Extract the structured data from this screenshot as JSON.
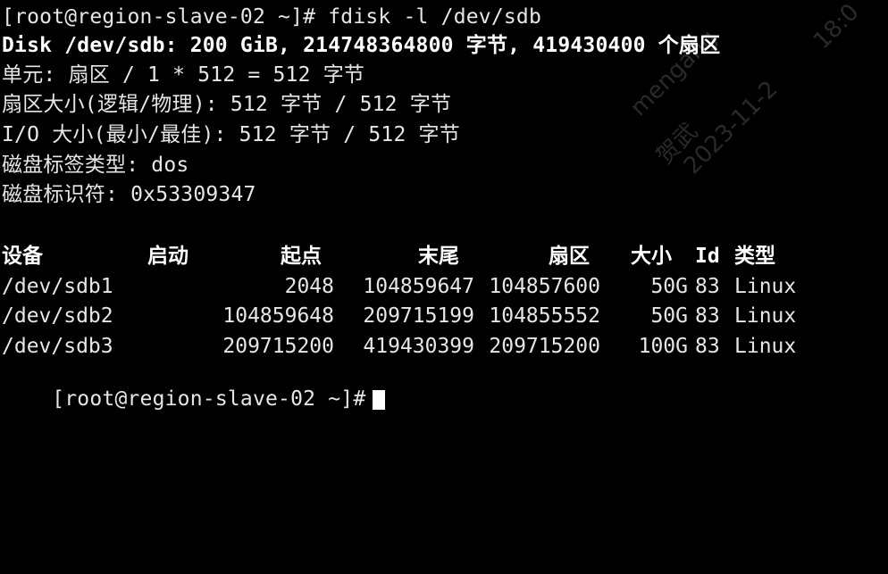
{
  "terminal": {
    "lines": [
      "[root@region-slave-02 ~]# fdisk -l /dev/sdb",
      "Disk /dev/sdb: 200 GiB, 214748364800 字节, 419430400 个扇区",
      "单元: 扇区 / 1 * 512 = 512 字节",
      "扇区大小(逻辑/物理): 512 字节 / 512 字节",
      "I/O 大小(最小/最佳): 512 字节 / 512 字节",
      "磁盘标签类型: dos",
      "磁盘标识符: 0x53309347"
    ],
    "table": {
      "headers": [
        "设备",
        "启动",
        "起点",
        "末尾",
        "扇区",
        "大小",
        "Id",
        "类型"
      ],
      "rows": [
        [
          "/dev/sdb1",
          "",
          "2048",
          "104859647",
          "104857600",
          "50G",
          "83",
          "Linux"
        ],
        [
          "/dev/sdb2",
          "",
          "104859648",
          "209715199",
          "104855552",
          "50G",
          "83",
          "Linux"
        ],
        [
          "/dev/sdb3",
          "",
          "209715200",
          "419430399",
          "209715200",
          "100G",
          "83",
          "Linux"
        ]
      ]
    },
    "prompt": "[root@region-slave-02 ~]#"
  },
  "watermark": {
    "user": "mengang",
    "name": "贺武",
    "date": "2023-11-2",
    "time": "18:0"
  },
  "colors": {
    "background": "#000000",
    "text": "#e6e6e6",
    "bold_text": "#ffffff"
  }
}
